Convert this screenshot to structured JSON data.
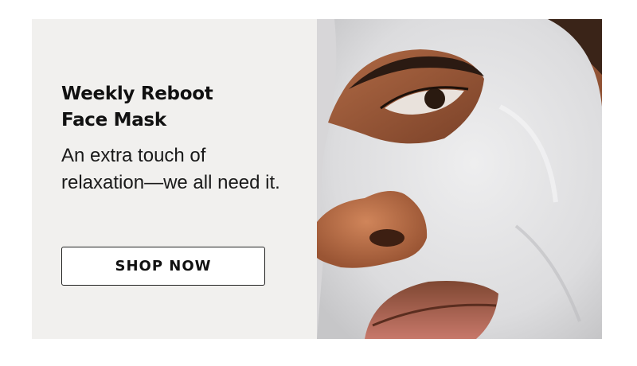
{
  "promo": {
    "title_line1": "Weekly Reboot",
    "title_line2": "Face Mask",
    "subtitle_line1": "An extra touch of",
    "subtitle_line2": "relaxation—we all need it.",
    "cta_label": "SHOP NOW"
  },
  "colors": {
    "panel_bg": "#f1f0ee",
    "text": "#111111",
    "button_border": "#222222"
  },
  "image": {
    "subject": "face-mask-photo"
  }
}
